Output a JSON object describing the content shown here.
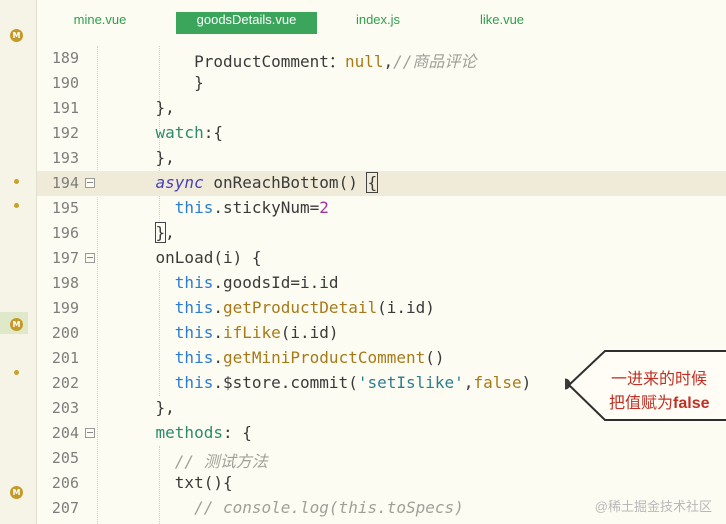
{
  "tabs": [
    {
      "label": "mine.vue"
    },
    {
      "label": "goodsDetails.vue",
      "active": true
    },
    {
      "label": "index.js"
    },
    {
      "label": "like.vue"
    }
  ],
  "gutter_marks": [
    {
      "type": "m-badge",
      "label": "M"
    },
    {
      "type": "dot"
    },
    {
      "type": "dot"
    },
    {
      "type": "m-badge",
      "label": "M"
    },
    {
      "type": "dot"
    },
    {
      "type": "m-badge",
      "label": "M"
    }
  ],
  "lines": [
    {
      "n": "189",
      "code": [
        [
          "k-prop",
          "        ProductComment"
        ],
        [
          "",
          "："
        ],
        [
          "k-null",
          "null"
        ],
        [
          "",
          ","
        ],
        [
          "k-com",
          "//商品评论"
        ]
      ]
    },
    {
      "n": "190",
      "code": [
        [
          "",
          "        }"
        ]
      ]
    },
    {
      "n": "191",
      "code": [
        [
          "",
          "    },"
        ]
      ]
    },
    {
      "n": "192",
      "code": [
        [
          "k-obj",
          "    watch"
        ],
        [
          "",
          ":{"
        ]
      ]
    },
    {
      "n": "193",
      "code": [
        [
          "",
          "    },"
        ]
      ]
    },
    {
      "n": "194",
      "current": true,
      "fold": true,
      "code": [
        [
          "k-async",
          "    async"
        ],
        [
          "",
          " onReachBottom() "
        ],
        [
          "bracket",
          "{"
        ]
      ]
    },
    {
      "n": "195",
      "code": [
        [
          "k-this",
          "      this"
        ],
        [
          "",
          ".stickyNum="
        ],
        [
          "k-num",
          "2"
        ]
      ]
    },
    {
      "n": "196",
      "code": [
        [
          "",
          "    "
        ],
        [
          "bracket",
          "}"
        ],
        [
          "",
          ","
        ]
      ]
    },
    {
      "n": "197",
      "fold": true,
      "code": [
        [
          "",
          "    onLoad(i) {"
        ]
      ]
    },
    {
      "n": "198",
      "code": [
        [
          "k-this",
          "      this"
        ],
        [
          "",
          ".goodsId=i.id"
        ]
      ]
    },
    {
      "n": "199",
      "code": [
        [
          "k-this",
          "      this"
        ],
        [
          "",
          "."
        ],
        [
          "k-fn",
          "getProductDetail"
        ],
        [
          "",
          "(i.id)"
        ]
      ]
    },
    {
      "n": "200",
      "code": [
        [
          "k-this",
          "      this"
        ],
        [
          "",
          "."
        ],
        [
          "k-fn",
          "ifLike"
        ],
        [
          "",
          "(i.id)"
        ]
      ]
    },
    {
      "n": "201",
      "code": [
        [
          "k-this",
          "      this"
        ],
        [
          "",
          "."
        ],
        [
          "k-fn",
          "getMiniProductComment"
        ],
        [
          "",
          "()"
        ]
      ]
    },
    {
      "n": "202",
      "code": [
        [
          "k-this",
          "      this"
        ],
        [
          "",
          ".$store.commit("
        ],
        [
          "k-str",
          "'setIslike'"
        ],
        [
          "",
          ","
        ],
        [
          "k-null",
          "false"
        ],
        [
          "",
          ")"
        ]
      ]
    },
    {
      "n": "203",
      "code": [
        [
          "",
          "    },"
        ]
      ]
    },
    {
      "n": "204",
      "fold": true,
      "code": [
        [
          "k-obj",
          "    methods"
        ],
        [
          "",
          ": {"
        ]
      ]
    },
    {
      "n": "205",
      "code": [
        [
          "k-com",
          "      // 测试方法"
        ]
      ]
    },
    {
      "n": "206",
      "code": [
        [
          "",
          "      txt(){"
        ]
      ]
    },
    {
      "n": "207",
      "code": [
        [
          "k-com",
          "        // console.log(this.toSpecs)"
        ]
      ]
    }
  ],
  "callout": {
    "line1": "一进来的时候",
    "line2_prefix": "把值赋为",
    "line2_bold": "false"
  },
  "watermark": "@稀土掘金技术社区"
}
